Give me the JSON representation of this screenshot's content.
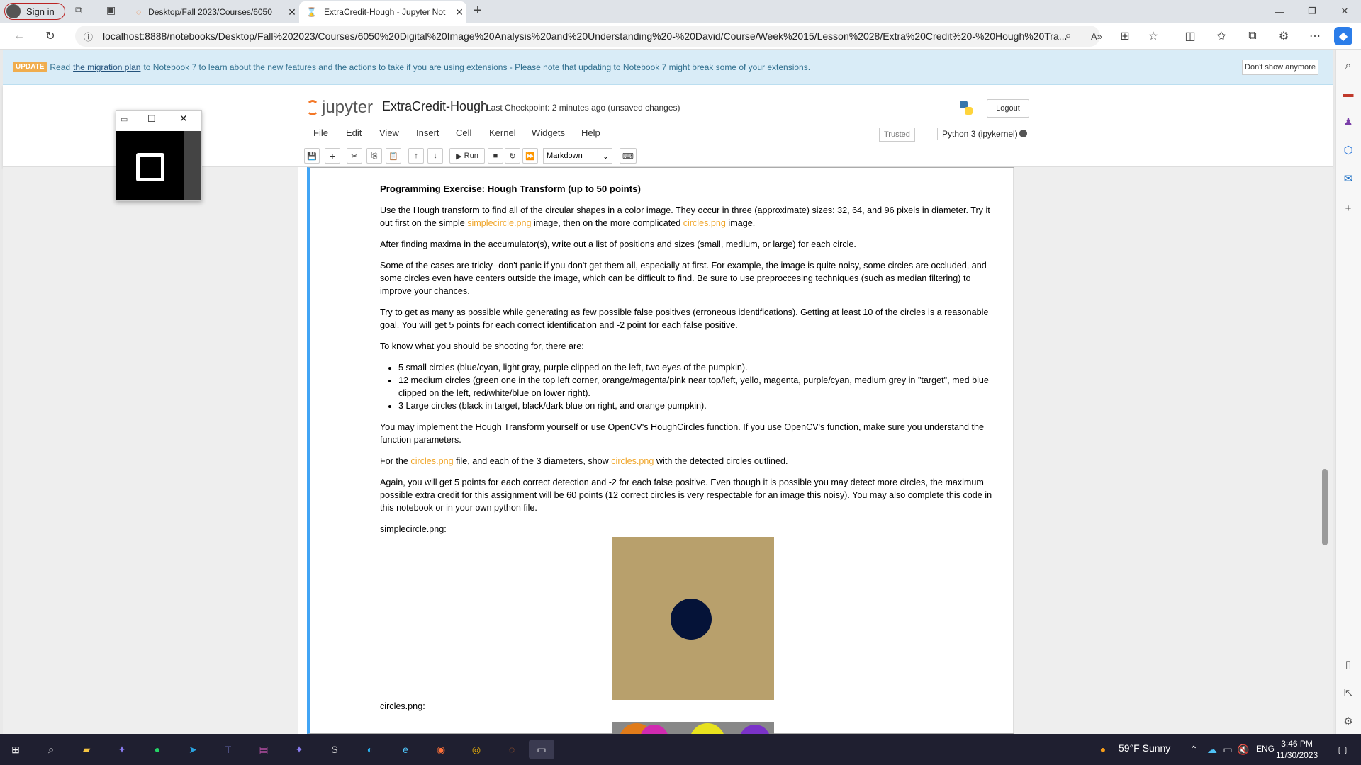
{
  "browser": {
    "sign_in": "Sign in",
    "tabs": [
      {
        "title": "Desktop/Fall 2023/Courses/6050"
      },
      {
        "title": "ExtraCredit-Hough - Jupyter Not"
      }
    ],
    "url": "localhost:8888/notebooks/Desktop/Fall%202023/Courses/6050%20Digital%20Image%20Analysis%20and%20Understanding%20-%20David/Course/Week%2015/Lesson%2028/Extra%20Credit%20-%20Hough%20Tra..."
  },
  "banner": {
    "badge": "UPDATE",
    "pre": "Read",
    "link": "the migration plan",
    "post": "to Notebook 7 to learn about the new features and the actions to take if you are using extensions - Please note that updating to Notebook 7 might break some of your extensions.",
    "dismiss": "Don't show anymore"
  },
  "jupyter": {
    "logo_text": "jupyter",
    "notebook_name": "ExtraCredit-Hough",
    "checkpoint": "Last Checkpoint: 2 minutes ago  (unsaved changes)",
    "logout": "Logout",
    "menus": [
      "File",
      "Edit",
      "View",
      "Insert",
      "Cell",
      "Kernel",
      "Widgets",
      "Help"
    ],
    "trusted": "Trusted",
    "kernel": "Python 3 (ipykernel)",
    "run_label": "Run",
    "cell_type": "Markdown"
  },
  "cell": {
    "heading": "Programming Exercise: Hough Transform (up to 50 points)",
    "p1_a": "Use the Hough transform to find all of the circular shapes in a color image. They occur in three (approximate) sizes: 32, 64, and 96 pixels in diameter. Try it out first on the simple ",
    "p1_link1": "simplecircle.png",
    "p1_b": " image, then on the more complicated ",
    "p1_link2": "circles.png",
    "p1_c": " image.",
    "p2": "After finding maxima in the accumulator(s), write out a list of positions and sizes (small, medium, or large) for each circle.",
    "p3": "Some of the cases are tricky--don't panic if you don't get them all, especially at first. For example, the image is quite noisy, some circles are occluded, and some circles even have centers outside the image, which can be difficult to find. Be sure to use preproccesing techniques (such as median filtering) to improve your chances.",
    "p4": "Try to get as many as possible while generating as few possible false positives (erroneous identifications). Getting at least 10 of the circles is a reasonable goal. You will get 5 points for each correct identification and -2 point for each false positive.",
    "p5": "To know what you should be shooting for, there are:",
    "bullets": [
      "5 small circles (blue/cyan, light gray, purple clipped on the left, two eyes of the pumpkin).",
      "12 medium circles (green one in the top left corner, orange/magenta/pink near top/left, yello, magenta, purple/cyan, medium grey in \"target\", med blue clipped on the left, red/white/blue on lower right).",
      "3 Large circles (black in target, black/dark blue on right, and orange pumpkin)."
    ],
    "p6": "You may implement the Hough Transform yourself or use OpenCV's HoughCircles function. If you use OpenCV's function, make sure you understand the function parameters.",
    "p7_a": "For the ",
    "p7_link1": "circles.png",
    "p7_b": " file, and each of the 3 diameters, show ",
    "p7_link2": "circles.png",
    "p7_c": " with the detected circles outlined.",
    "p8": "Again, you will get 5 points for each correct detection and -2 for each false positive. Even though it is possible you may detect more circles, the maximum possible extra credit for this assignment will be 60 points (12 correct circles is very respectable for an image this noisy). You may also complete this code in this notebook or in your own python file.",
    "simple_label": "simplecircle.png:",
    "circles_label": "circles.png:"
  },
  "taskbar": {
    "weather": "59°F  Sunny",
    "lang": "ENG",
    "time": "3:46 PM",
    "date": "11/30/2023"
  }
}
